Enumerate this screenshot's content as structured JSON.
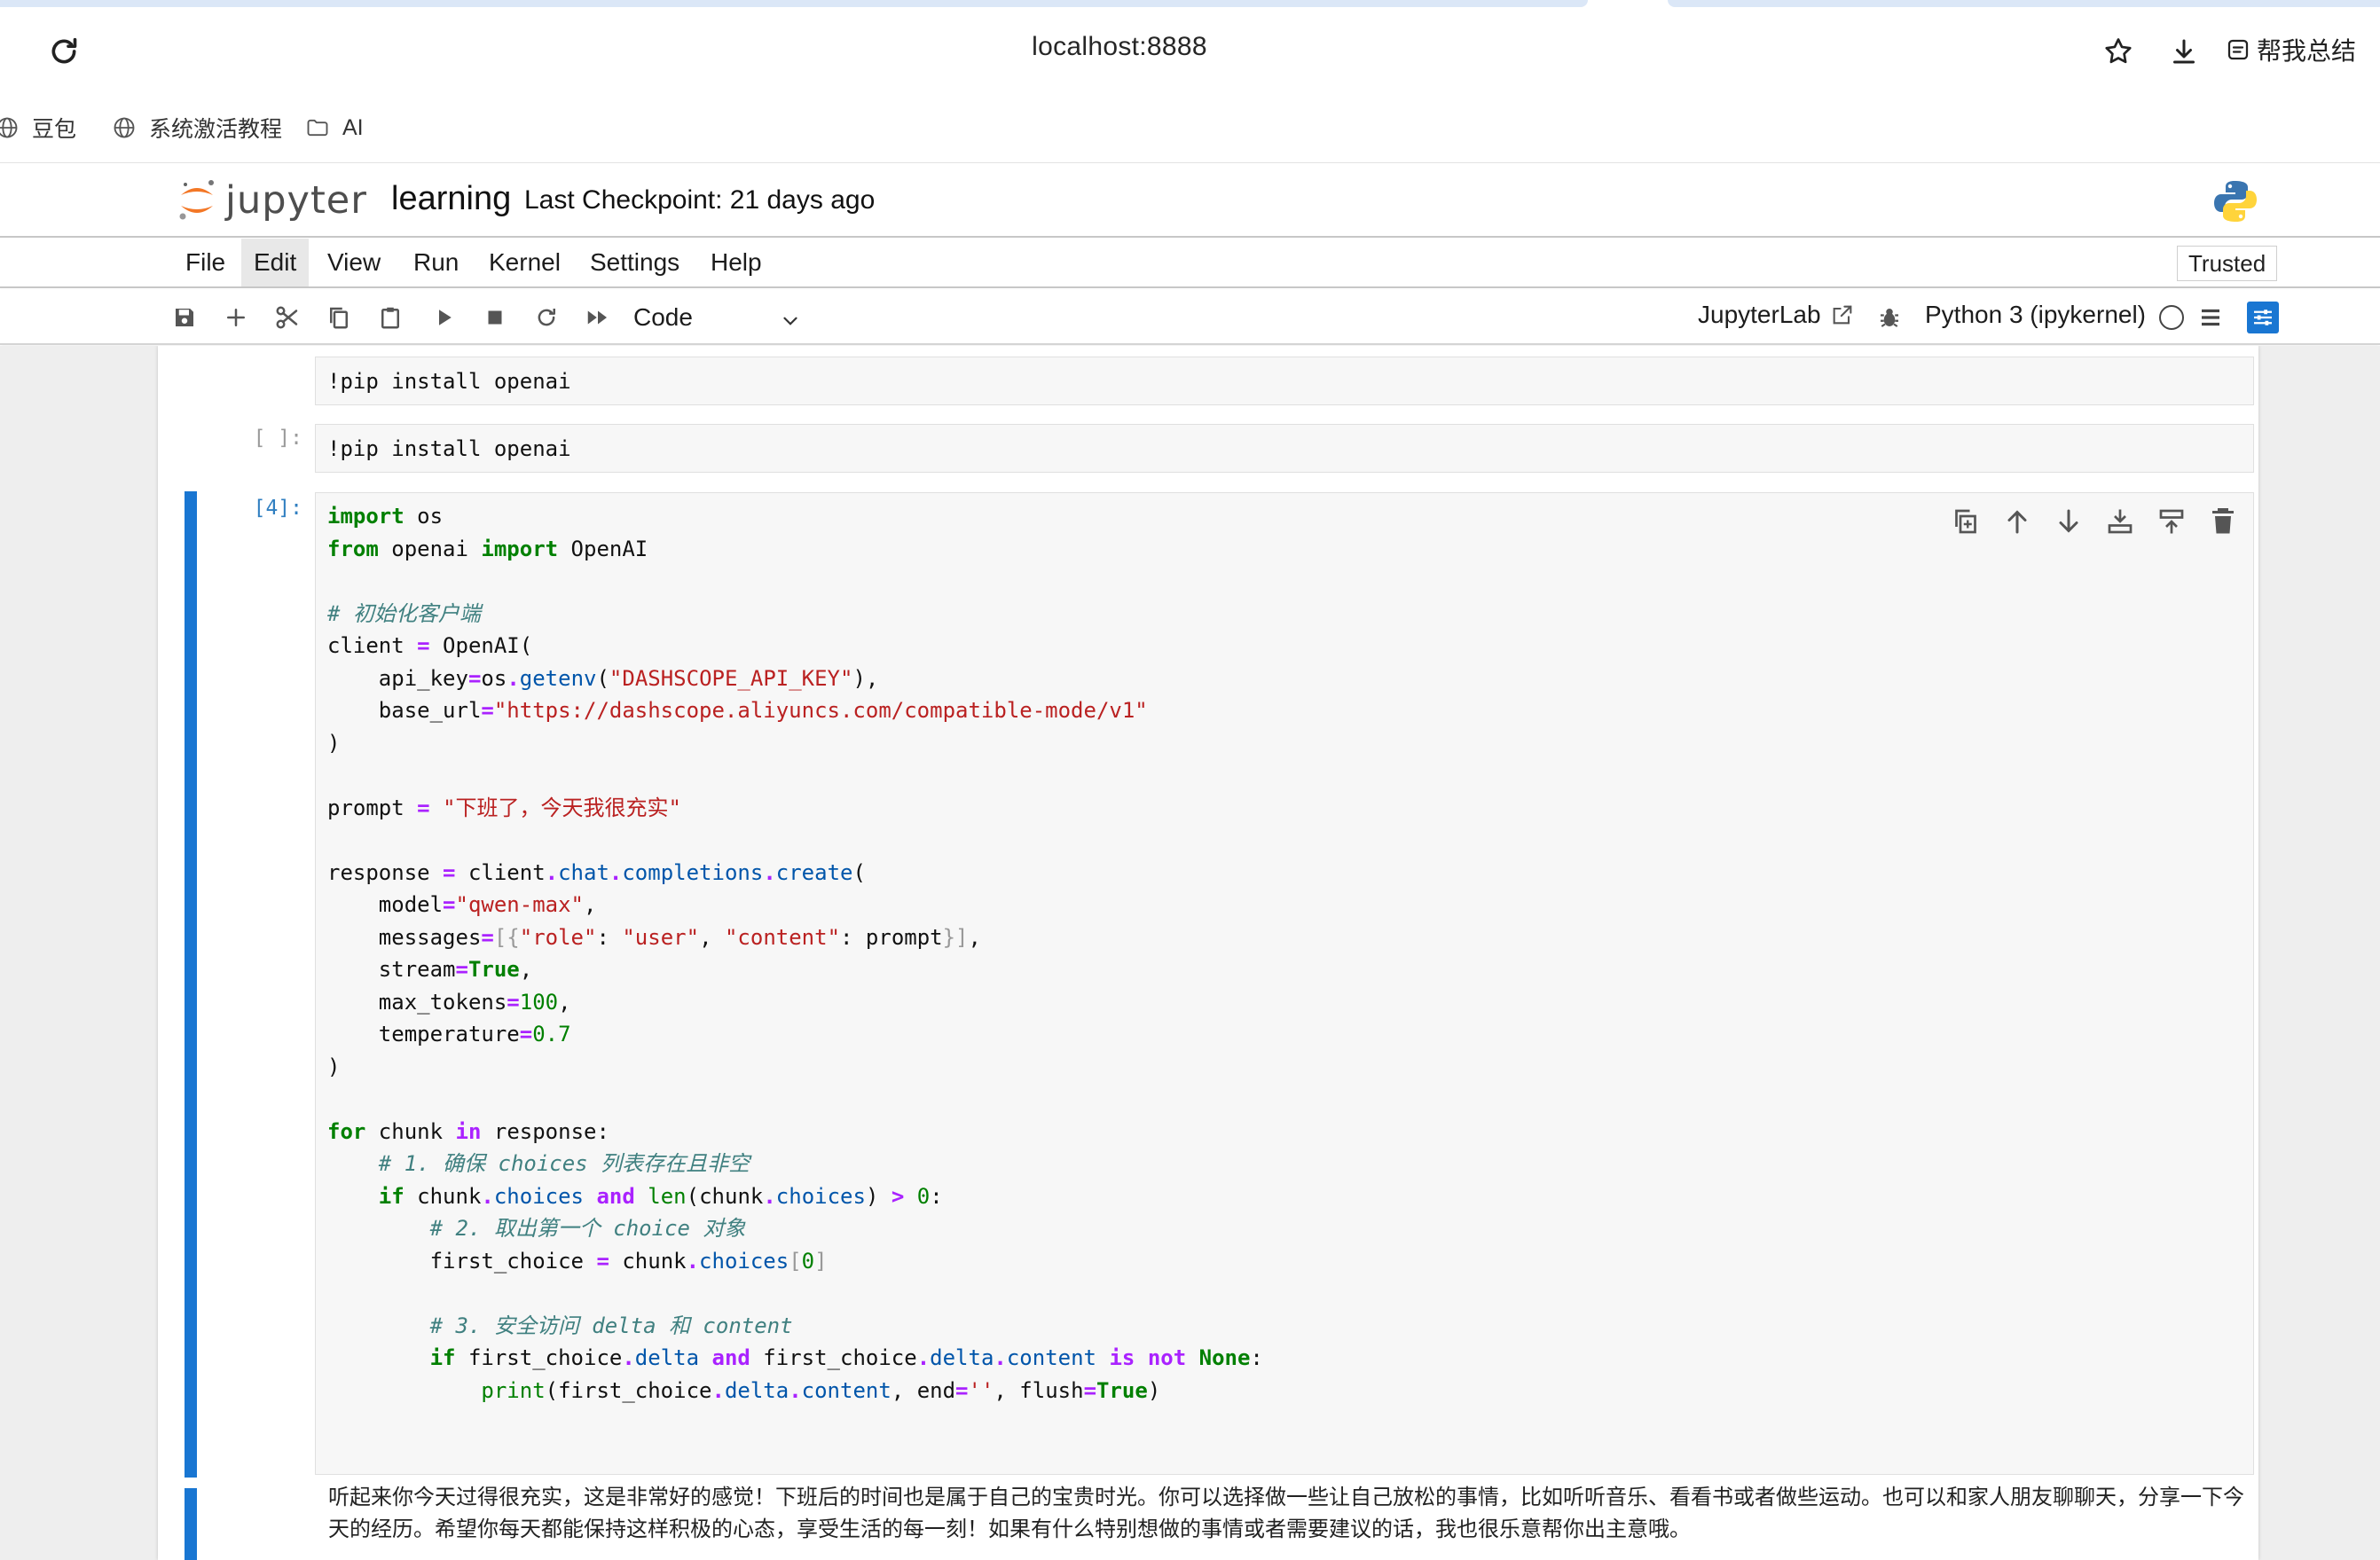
{
  "browser": {
    "url": "localhost:8888",
    "summary_label": "帮我总结",
    "bookmarks": [
      {
        "label": "豆包",
        "icon": "globe-icon"
      },
      {
        "label": "系统激活教程",
        "icon": "globe-icon"
      },
      {
        "label": "AI",
        "icon": "folder-icon"
      }
    ]
  },
  "jupyter": {
    "wordmark": "jupyter",
    "notebook_title": "learning",
    "checkpoint": "Last Checkpoint: 21 days ago",
    "menu": [
      "File",
      "Edit",
      "View",
      "Run",
      "Kernel",
      "Settings",
      "Help"
    ],
    "active_menu": "Edit",
    "trusted": "Trusted",
    "cell_type": "Code",
    "jupyterlab_link": "JupyterLab",
    "kernel_name": "Python 3 (ipykernel)"
  },
  "cells": {
    "cell1": {
      "prompt": "",
      "source": "!pip install openai"
    },
    "cell2": {
      "prompt": "[ ]:",
      "source": "!pip install openai"
    },
    "cell3": {
      "prompt": "[4]:"
    }
  },
  "output": {
    "text": "听起来你今天过得很充实，这是非常好的感觉！下班后的时间也是属于自己的宝贵时光。你可以选择做一些让自己放松的事情，比如听听音乐、看看书或者做些运动。也可以和家人朋友聊聊天，分享一下今天的经历。希望你每天都能保持这样积极的心态，享受生活的每一刻！如果有什么特别想做的事情或者需要建议的话，我也很乐意帮你出主意哦。"
  },
  "colors": {
    "accent": "#1976d2",
    "active_prompt": "#307fc1",
    "keyword": "#008000",
    "string": "#ba2121",
    "comment": "#408080"
  }
}
